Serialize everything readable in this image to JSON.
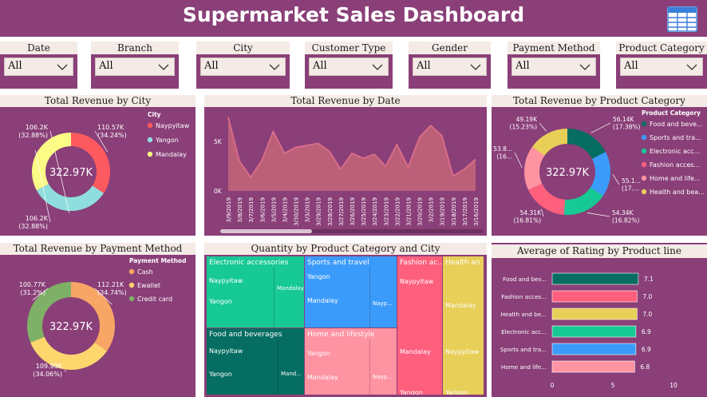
{
  "header": {
    "title": "Supermarket Sales Dashboard",
    "icon": "table-icon"
  },
  "colors": {
    "background": "#8a3f78",
    "header_band": "#f5ebe6",
    "red": "#fd5a5f",
    "teal": "#1acbb8",
    "yellow": "#fcfb86",
    "dark_teal": "#056d61",
    "blue": "#3b9bfb",
    "green": "#17c994",
    "pink": "#fd5f7d",
    "light_pink": "#fe93a2",
    "gold": "#e8cf58",
    "orange": "#f7a666",
    "light_orange": "#fdd66d",
    "olive_green": "#7fb067"
  },
  "slicers": [
    {
      "label": "Date",
      "value": "All"
    },
    {
      "label": "Branch",
      "value": "All"
    },
    {
      "label": "City",
      "value": "All"
    },
    {
      "label": "Customer Type",
      "value": "All"
    },
    {
      "label": "Gender",
      "value": "All"
    },
    {
      "label": "Payment Method",
      "value": "All"
    },
    {
      "label": "Product Category",
      "value": "All"
    }
  ],
  "chart_data": [
    {
      "id": "revenue_by_city",
      "type": "pie",
      "title": "Total Revenue by City",
      "legend_title": "City",
      "center_label": "322.97K",
      "legend_position": "right",
      "categories": [
        "Naypyitaw",
        "Yangon",
        "Mandalay"
      ],
      "values": [
        110.57,
        106.2,
        106.2
      ],
      "value_labels": [
        "110.57K",
        "106.2K",
        "106.2K"
      ],
      "percent_labels": [
        "(34.24%)",
        "(32.88%)",
        "(32.88%)"
      ],
      "colors": [
        "#fd5a5f",
        "#8fdedd",
        "#fcfb86"
      ]
    },
    {
      "id": "revenue_by_date",
      "type": "area",
      "title": "Total Revenue by Date",
      "y_ticks": [
        "5K",
        "0K"
      ],
      "ylim": [
        0,
        7500
      ],
      "x": [
        "3/9/2019",
        "3/8/2019",
        "3/7/2019",
        "3/6/2019",
        "3/5/2019",
        "3/4/2019",
        "3/30/2019",
        "3/3/2019",
        "3/29/2019",
        "3/28/2019",
        "3/27/2019",
        "3/26/2019",
        "3/25/2019",
        "3/24/2019",
        "3/23/2019",
        "3/22/2019",
        "3/21/2019",
        "3/20/2019",
        "3/2/2019",
        "3/19/2019",
        "3/18/2019",
        "3/17/2019",
        "3/16/2019"
      ],
      "values": [
        7450,
        3000,
        1400,
        3100,
        6000,
        3800,
        4400,
        4600,
        4800,
        4000,
        2200,
        3800,
        3300,
        3700,
        2500,
        4700,
        2400,
        5400,
        6600,
        5600,
        1500,
        2200,
        3200
      ],
      "color": "#c4667a"
    },
    {
      "id": "revenue_by_product_category",
      "type": "pie",
      "title": "Total Revenue by Product Category",
      "legend_title": "Product Category",
      "center_label": "322.97K",
      "legend_position": "right",
      "categories": [
        "Food and beve...",
        "Sports and tra...",
        "Electronic acc...",
        "Fashion acces...",
        "Home and life...",
        "Health and bea..."
      ],
      "values": [
        56.14,
        55.12,
        54.34,
        54.31,
        53.86,
        49.19
      ],
      "value_labels": [
        "56.14K",
        "55.1...",
        "54.34K",
        "54.31K",
        "53.8...",
        "49.19K"
      ],
      "percent_labels": [
        "(17.38%)",
        "(17....",
        "(16.82%)",
        "(16.81%)",
        "(16...",
        "(15.23%)"
      ],
      "colors": [
        "#056d61",
        "#3b9bfb",
        "#17c994",
        "#fd5f7d",
        "#fe93a2",
        "#e8cf58"
      ]
    },
    {
      "id": "revenue_by_payment_method",
      "type": "pie",
      "title": "Total Revenue by Payment Method",
      "legend_title": "Payment Method",
      "center_label": "322.97K",
      "legend_position": "right",
      "categories": [
        "Cash",
        "Ewallet",
        "Credit card"
      ],
      "values": [
        112.21,
        109.99,
        100.77
      ],
      "value_labels": [
        "112.21K",
        "109.99K",
        "100.77K"
      ],
      "percent_labels": [
        "(34.74%)",
        "(34.06%)",
        "(31.2%)"
      ],
      "colors": [
        "#f7a666",
        "#fdd66d",
        "#7fb067"
      ]
    },
    {
      "id": "quantity_treemap",
      "type": "heatmap",
      "title": "Quantity by Product Category and City",
      "groups": [
        {
          "name": "Electronic accessories",
          "color": "#17c994",
          "cells": [
            "Naypyitaw",
            "Yangon",
            "Mandalay"
          ]
        },
        {
          "name": "Food and beverages",
          "color": "#056d61",
          "cells": [
            "Naypyitaw",
            "Yangon",
            "Mand..."
          ]
        },
        {
          "name": "Sports and travel",
          "color": "#3b9bfb",
          "cells": [
            "Yangon",
            "Mandalay",
            "Nayp..."
          ]
        },
        {
          "name": "Home and lifestyle",
          "color": "#fe93a2",
          "cells": [
            "Yangon",
            "Mandalay",
            "Nayp..."
          ]
        },
        {
          "name": "Fashion ac...",
          "color": "#fd5f7d",
          "cells": [
            "Naypyitaw",
            "Mandalay",
            "Yangon"
          ]
        },
        {
          "name": "Health an...",
          "color": "#e8cf58",
          "cells": [
            "Mandalay",
            "Naypyitaw",
            "Yangon"
          ]
        }
      ]
    },
    {
      "id": "rating_by_product_line",
      "type": "bar",
      "title": "Average of Rating by Product line",
      "categories": [
        "Food and bev...",
        "Fashion acces...",
        "Health and be...",
        "Electronic acc...",
        "Sports and tra...",
        "Home and life..."
      ],
      "values": [
        7.1,
        7.0,
        7.0,
        6.9,
        6.9,
        6.8
      ],
      "value_labels": [
        "7.1",
        "7.0",
        "7.0",
        "6.9",
        "6.9",
        "6.8"
      ],
      "x_ticks": [
        "0",
        "5",
        "10"
      ],
      "xlim": [
        0,
        10
      ],
      "colors": [
        "#056d61",
        "#fd5f7d",
        "#e8cf58",
        "#17c994",
        "#3b9bfb",
        "#fe93a2"
      ]
    }
  ]
}
